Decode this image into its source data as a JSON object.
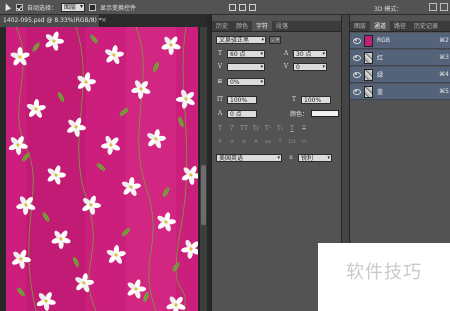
{
  "options_bar": {
    "auto_select_label": "自动选择：",
    "auto_select_mode": "图层",
    "show_transform_label": "显示变换控件",
    "mode_3d_label": "3D 模式："
  },
  "document": {
    "tab_title": "1402-095.psd @ 8.33%(RGB/8) *",
    "close_glyph": "×"
  },
  "character_panel": {
    "tabs": [
      "历史",
      "颜色",
      "字符",
      "段落"
    ],
    "active_tab": "字符",
    "font_family": "文泉驿正黑",
    "font_style": "-",
    "font_size": "60 点",
    "leading": "30 点",
    "kerning": "",
    "tracking": "0",
    "scale_percent": "0%",
    "vertical_scale": "100%",
    "horizontal_scale": "100%",
    "baseline_shift": "0 点",
    "color_label": "颜色：",
    "color_value": "#f2f2f2",
    "type_style_buttons": [
      "T",
      "T",
      "TT",
      "Tr",
      "T¹",
      "T₁",
      "T",
      "T"
    ],
    "opentype_buttons": [
      "fi",
      "σ",
      "st",
      "A",
      "aa",
      "T",
      "1st",
      "½"
    ],
    "language": "美国英语",
    "antialias": "锐利"
  },
  "channels_panel": {
    "tabs": [
      "图层",
      "通道",
      "路径",
      "历史记录"
    ],
    "active_tab": "通道",
    "channels": [
      {
        "name": "RGB",
        "shortcut": "⌘2",
        "thumb": "color"
      },
      {
        "name": "红",
        "shortcut": "⌘3",
        "thumb": "gray"
      },
      {
        "name": "绿",
        "shortcut": "⌘4",
        "thumb": "gray"
      },
      {
        "name": "蓝",
        "shortcut": "⌘5",
        "thumb": "gray"
      }
    ]
  },
  "watermark": {
    "text": "软件技巧"
  },
  "colors": {
    "artwork_base": "#cc1f7d",
    "selected_channel": "#55637a",
    "panel_bg": "#535353"
  }
}
